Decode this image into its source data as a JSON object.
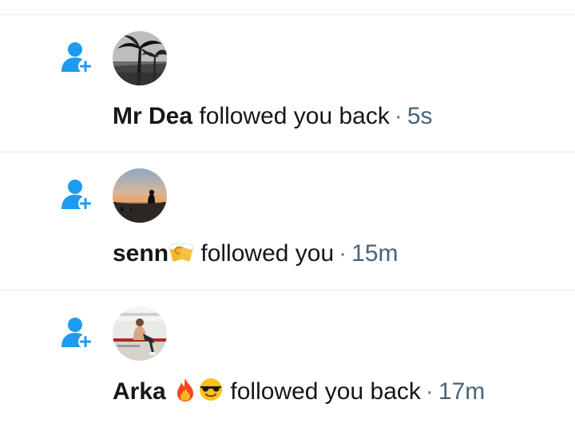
{
  "notifications": [
    {
      "icon": "follow-user-icon",
      "avatar": "avatar-palm-trees-bw",
      "name": "Mr Dea",
      "emoji": "",
      "action": "followed you back",
      "separator": "·",
      "time": "5s"
    },
    {
      "icon": "follow-user-icon",
      "avatar": "avatar-sunset-beach",
      "name": "senn",
      "emoji": "beer-mugs-emoji",
      "action": "followed you",
      "separator": "·",
      "time": "15m"
    },
    {
      "icon": "follow-user-icon",
      "avatar": "avatar-person-sitting",
      "name": "Arka",
      "emoji": "fire-emoji, sunglasses-face-emoji",
      "action": "followed you back",
      "separator": "·",
      "time": "17m"
    }
  ],
  "colors": {
    "accent": "#1d9bf0",
    "divider": "#e6ecf0",
    "text": "#14171a",
    "secondary": "#4a6378"
  }
}
